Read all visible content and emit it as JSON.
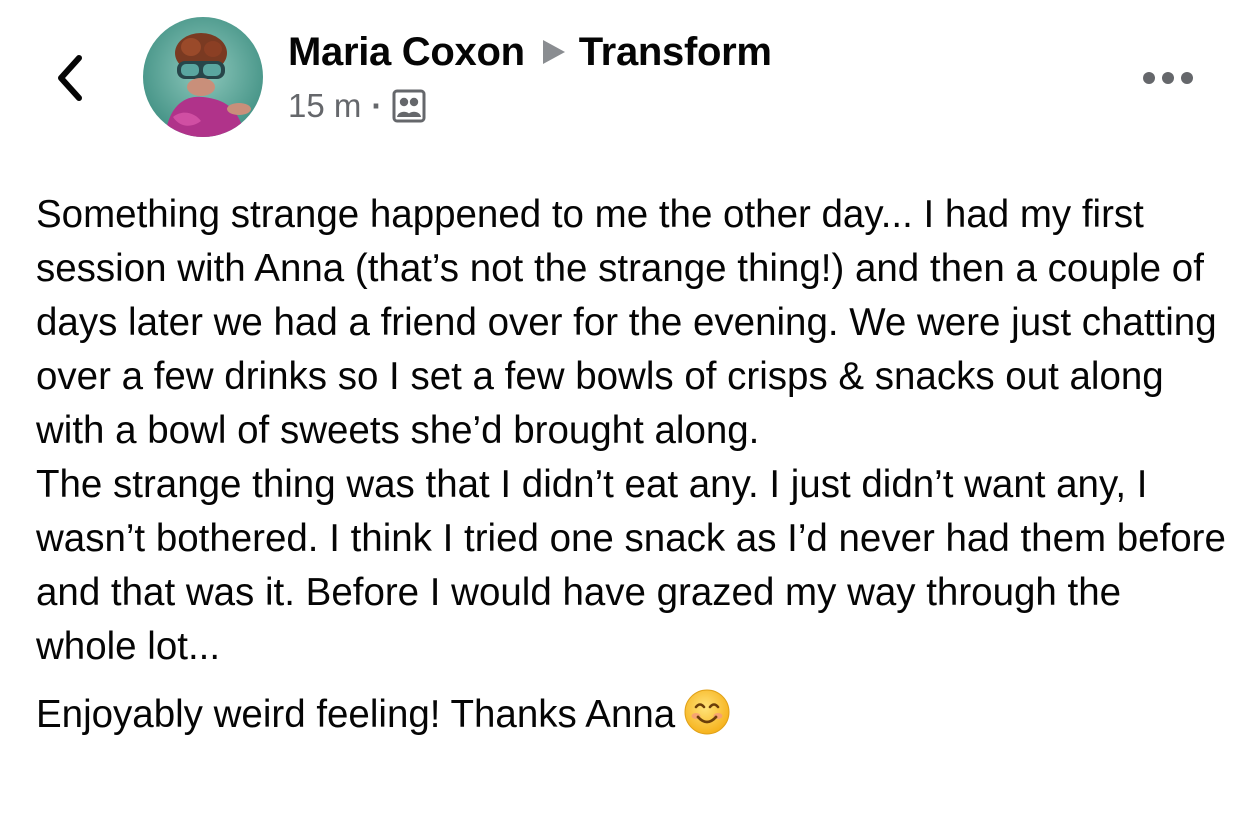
{
  "header": {
    "author": "Maria Coxon",
    "group": "Transform",
    "timestamp": "15 m",
    "separator": "·",
    "back_icon": "chevron-left-icon",
    "audience_icon": "group-audience-icon",
    "more_icon": "more-options-icon"
  },
  "post": {
    "paragraphs": [
      "Something strange happened to me the other day... I had my first session with Anna (that’s not the strange thing!) and then a couple of days later we had a friend over for the evening. We were just chatting over a few drinks so I set a few bowls of crisps & snacks out along with a bowl of sweets she’d brought along.",
      "The strange thing was that I didn’t eat any. I just didn’t want any, I wasn’t bothered. I think I tried one snack as I’d never had them before and that was it. Before I would have grazed my way through the whole lot...",
      "Enjoyably weird feeling! Thanks Anna"
    ],
    "closing_emoji": "smiling-face-emoji"
  },
  "colors": {
    "text": "#050505",
    "secondary_text": "#65676b",
    "arrow": "#8a8d91",
    "background": "#ffffff"
  }
}
